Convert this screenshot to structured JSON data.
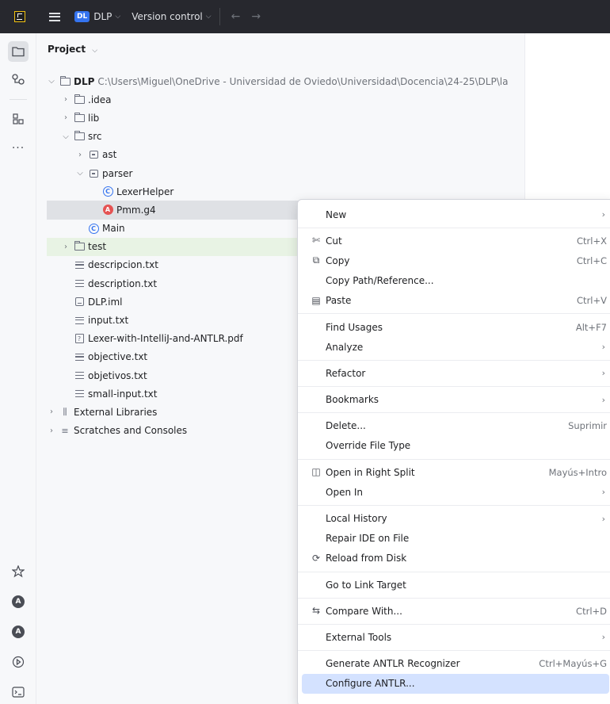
{
  "titlebar": {
    "project_badge": "DL",
    "project_name": "DLP",
    "vcs_label": "Version control",
    "back_icon": "arrow-left-icon",
    "forward_icon": "arrow-right-icon"
  },
  "panel": {
    "title": "Project"
  },
  "tree": {
    "root": {
      "name": "DLP",
      "path": "C:\\Users\\Miguel\\OneDrive - Universidad de Oviedo\\Universidad\\Docencia\\24-25\\DLP\\la"
    },
    "items": [
      {
        "label": ".idea"
      },
      {
        "label": "lib"
      },
      {
        "label": "src"
      },
      {
        "label": "ast"
      },
      {
        "label": "parser"
      },
      {
        "label": "LexerHelper"
      },
      {
        "label": "Pmm.g4"
      },
      {
        "label": "Main"
      },
      {
        "label": "test"
      },
      {
        "label": "descripcion.txt"
      },
      {
        "label": "description.txt"
      },
      {
        "label": "DLP.iml"
      },
      {
        "label": "input.txt"
      },
      {
        "label": "Lexer-with-IntelliJ-and-ANTLR.pdf"
      },
      {
        "label": "objective.txt"
      },
      {
        "label": "objetivos.txt"
      },
      {
        "label": "small-input.txt"
      },
      {
        "label": "External Libraries"
      },
      {
        "label": "Scratches and Consoles"
      }
    ]
  },
  "menu": {
    "new": "New",
    "cut": "Cut",
    "cut_sc": "Ctrl+X",
    "copy": "Copy",
    "copy_sc": "Ctrl+C",
    "copy_path": "Copy Path/Reference...",
    "paste": "Paste",
    "paste_sc": "Ctrl+V",
    "find_usages": "Find Usages",
    "find_usages_sc": "Alt+F7",
    "analyze": "Analyze",
    "refactor": "Refactor",
    "bookmarks": "Bookmarks",
    "delete": "Delete...",
    "delete_sc": "Suprimir",
    "override": "Override File Type",
    "open_right": "Open in Right Split",
    "open_right_sc": "Mayús+Intro",
    "open_in": "Open In",
    "local_history": "Local History",
    "repair": "Repair IDE on File",
    "reload": "Reload from Disk",
    "go_link": "Go to Link Target",
    "compare": "Compare With...",
    "compare_sc": "Ctrl+D",
    "external_tools": "External Tools",
    "generate": "Generate ANTLR Recognizer",
    "generate_sc": "Ctrl+Mayús+G",
    "configure": "Configure ANTLR..."
  }
}
